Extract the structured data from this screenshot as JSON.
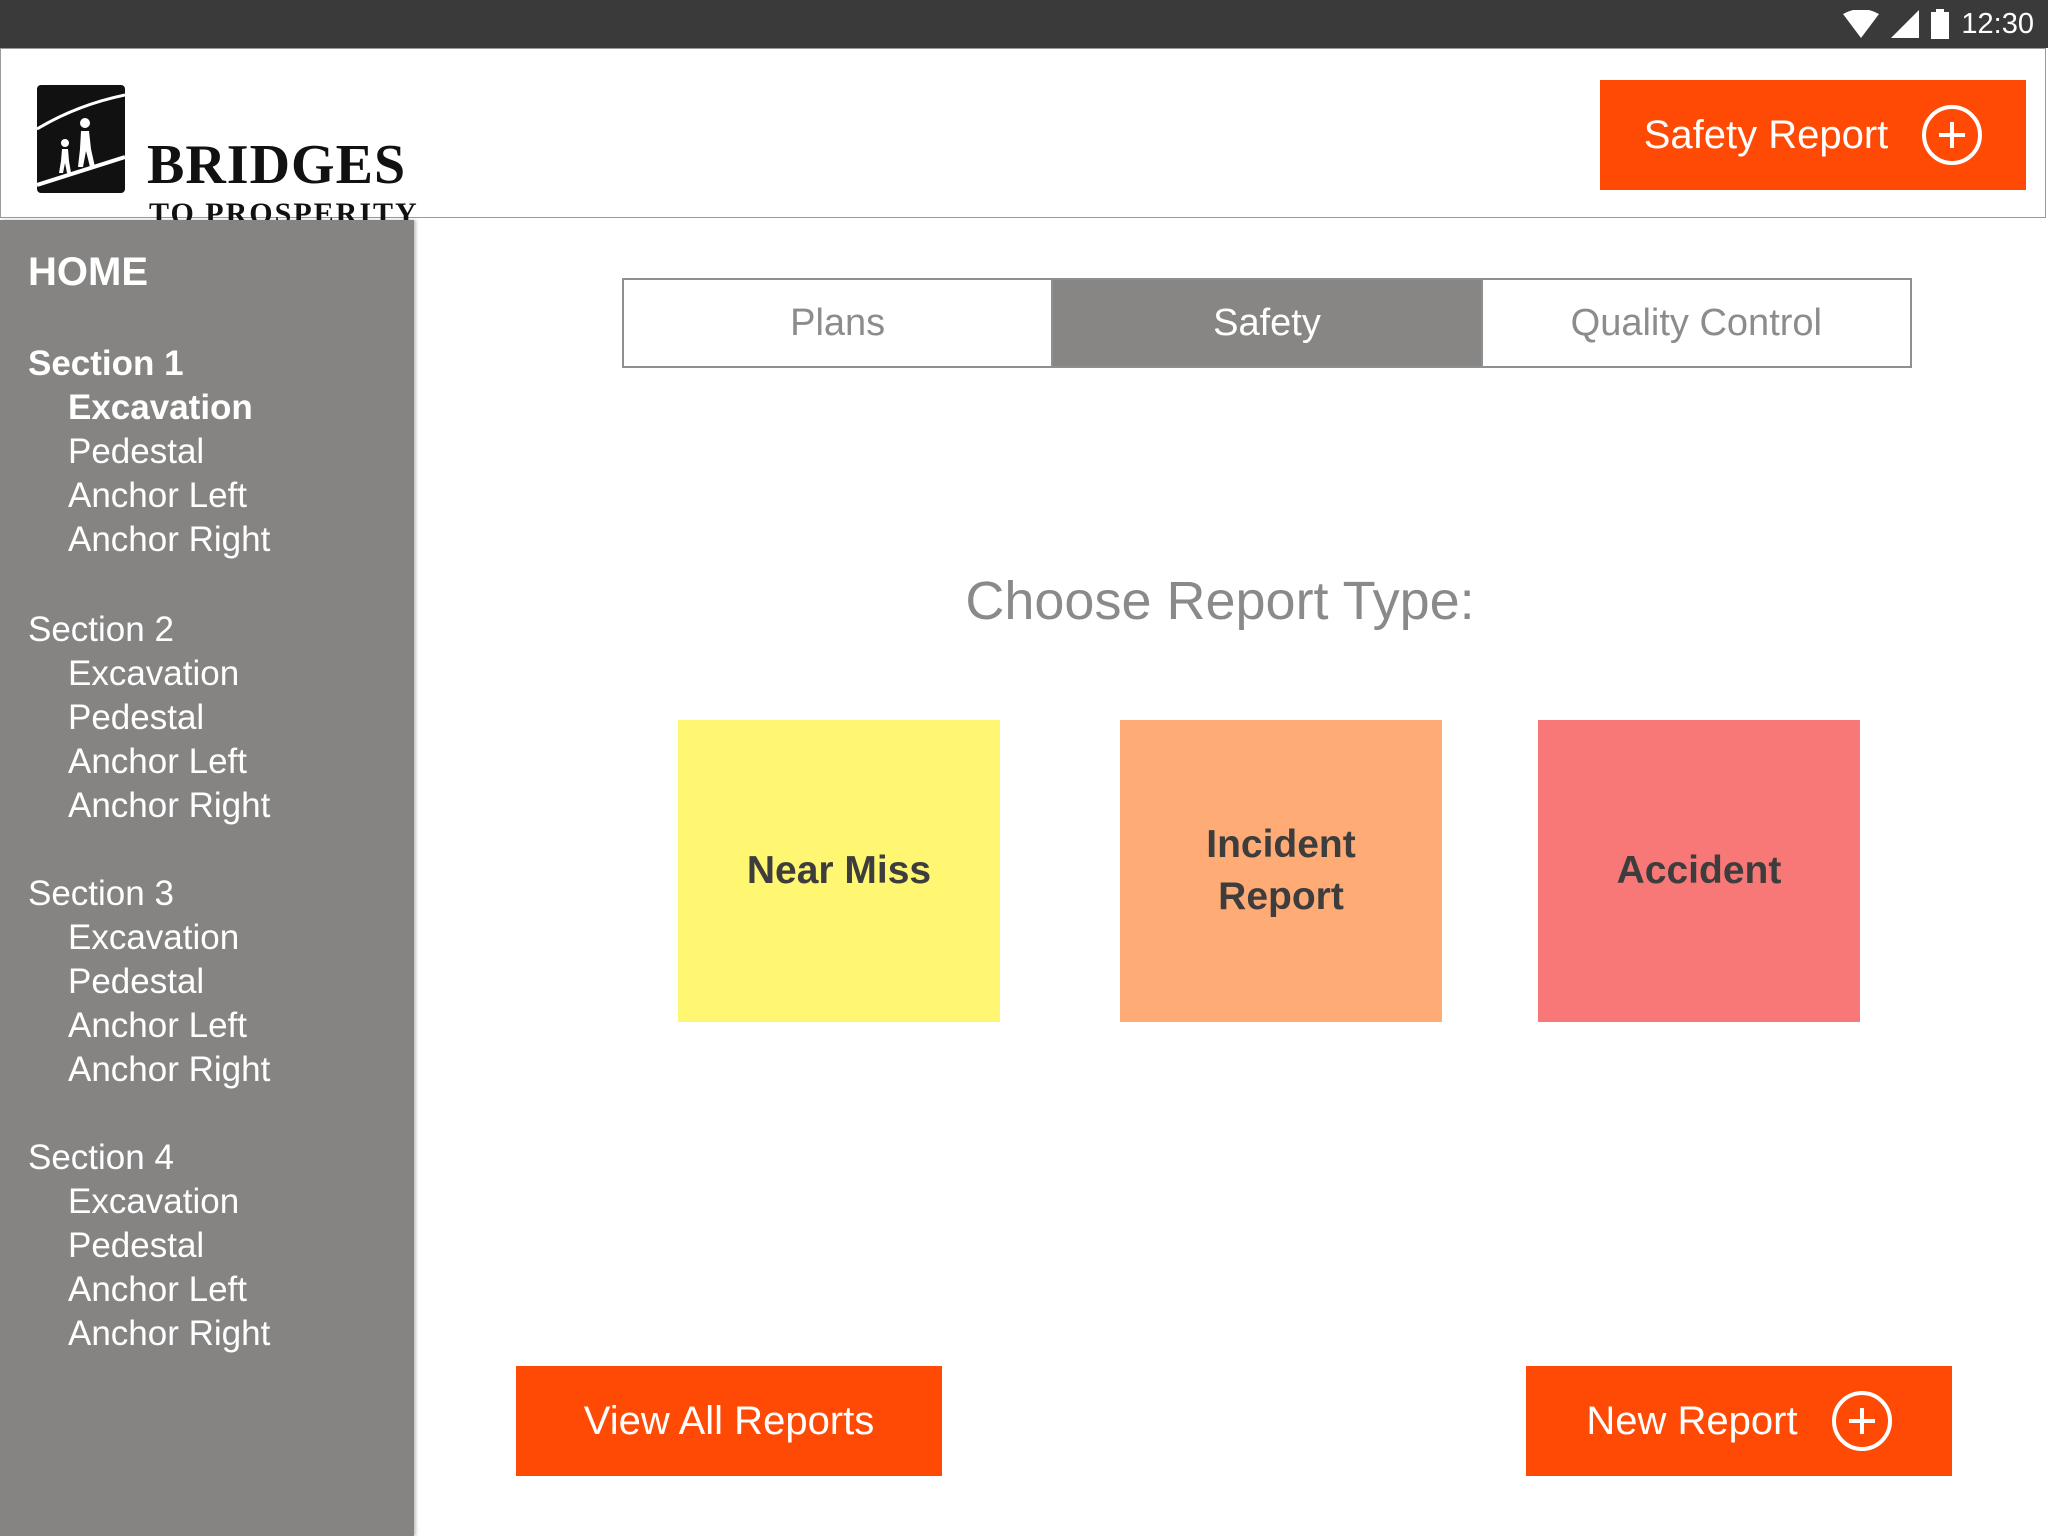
{
  "statusbar": {
    "time": "12:30",
    "icons": [
      "wifi-icon",
      "cell-signal-icon",
      "battery-icon"
    ]
  },
  "header": {
    "logo_title": "BRIDGES",
    "logo_subtitle": "TO PROSPERITY",
    "safety_report_label": "Safety Report"
  },
  "sidebar": {
    "home_label": "HOME",
    "sections": [
      {
        "title": "Section 1",
        "items": [
          "Excavation",
          "Pedestal",
          "Anchor Left",
          "Anchor Right"
        ]
      },
      {
        "title": "Section 2",
        "items": [
          "Excavation",
          "Pedestal",
          "Anchor Left",
          "Anchor Right"
        ]
      },
      {
        "title": "Section 3",
        "items": [
          "Excavation",
          "Pedestal",
          "Anchor Left",
          "Anchor Right"
        ]
      },
      {
        "title": "Section 4",
        "items": [
          "Excavation",
          "Pedestal",
          "Anchor Left",
          "Anchor Right"
        ]
      }
    ],
    "active_section": "Section 1",
    "active_item": "Excavation"
  },
  "tabs": [
    {
      "label": "Plans",
      "active": false
    },
    {
      "label": "Safety",
      "active": true
    },
    {
      "label": "Quality Control",
      "active": false
    }
  ],
  "main": {
    "heading": "Choose Report Type:",
    "report_types": [
      {
        "label": "Near Miss",
        "color": "#fff671"
      },
      {
        "label": "Incident Report",
        "color": "#ffab76"
      },
      {
        "label": "Accident",
        "color": "#f87777"
      }
    ],
    "view_all_label": "View All Reports",
    "new_report_label": "New Report"
  },
  "colors": {
    "accent": "#ff4a05",
    "sidebar": "#858483",
    "statusbar": "#3a3a3a",
    "active_tab": "#878685"
  }
}
